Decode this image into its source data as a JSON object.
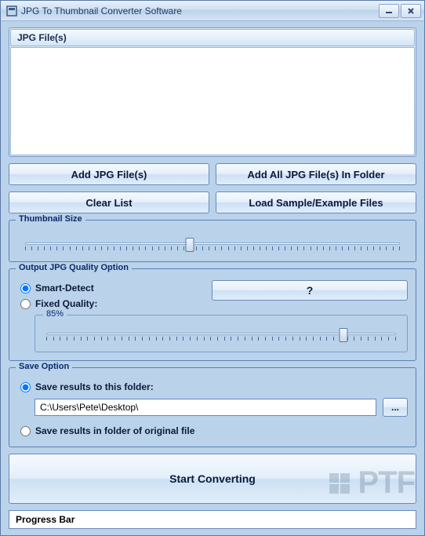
{
  "window": {
    "title": "JPG To Thumbnail Converter Software"
  },
  "fileList": {
    "header": "JPG File(s)"
  },
  "buttons": {
    "addFiles": "Add JPG File(s)",
    "addFolder": "Add All JPG File(s) In Folder",
    "clearList": "Clear List",
    "loadSample": "Load Sample/Example Files",
    "browse": "...",
    "help": "?",
    "start": "Start Converting"
  },
  "groups": {
    "thumbnailSize": "Thumbnail Size",
    "outputQuality": "Output JPG Quality Option",
    "saveOption": "Save Option"
  },
  "quality": {
    "smartDetect": "Smart-Detect",
    "fixedQuality": "Fixed Quality:",
    "percentLabel": "85%",
    "sliderPercent": 85,
    "selected": "smart"
  },
  "thumbnail": {
    "sliderPercent": 44
  },
  "save": {
    "toFolder": "Save results to this folder:",
    "inOriginal": "Save results in folder of original file",
    "path": "C:\\Users\\Pete\\Desktop\\",
    "selected": "folder"
  },
  "progress": {
    "label": "Progress Bar"
  },
  "watermark": "PTF"
}
